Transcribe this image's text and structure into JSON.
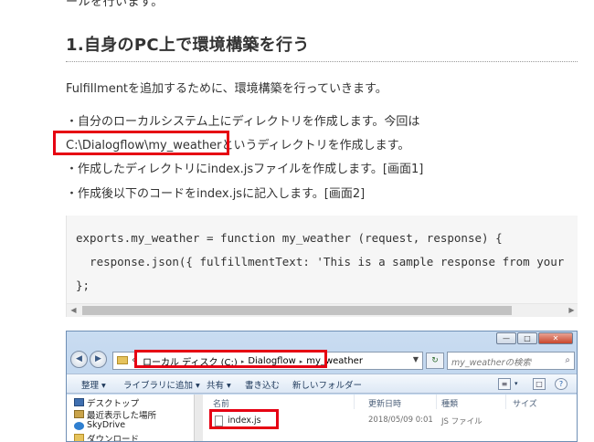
{
  "article": {
    "top_cut_text": "ールを行います。",
    "heading": "1.自身のPC上で環境構築を行う",
    "intro": "Fulfillmentを追加するために、環境構築を行っていきます。",
    "bullet1_line1": "・自分のローカルシステム上にディレクトリを作成します。今回は",
    "bullet1_path": "C:\\Dialogflow\\my_weather",
    "bullet1_line2_rest": "というディレクトリを作成します。",
    "bullet2": "・作成したディレクトリにindex.jsファイルを作成します。[画面1]",
    "bullet3": "・作成後以下のコードをindex.jsに記入します。[画面2]"
  },
  "code": {
    "lines": [
      "exports.my_weather = function my_weather (request, response) {",
      "  response.json({ fulfillmentText: 'This is a sample response from your",
      "};"
    ]
  },
  "explorer": {
    "address": {
      "prefix": "«",
      "crumbs": [
        "ローカル ディスク (C:)",
        "Dialogflow",
        "my_weather"
      ],
      "separator": "▸"
    },
    "search_placeholder": "my_weatherの検索",
    "toolbar": {
      "organize": "整理 ▾",
      "include_library": "ライブラリに追加 ▾",
      "share": "共有 ▾",
      "burn": "書き込む",
      "new_folder": "新しいフォルダー"
    },
    "nav_items": [
      "デスクトップ",
      "最近表示した場所",
      "SkyDrive",
      "ダウンロード"
    ],
    "columns": {
      "name": "名前",
      "date": "更新日時",
      "type": "種類",
      "size": "サイズ"
    },
    "files": [
      {
        "name": "index.js",
        "date": "2018/05/09 0:01",
        "type": "JS ファイル"
      }
    ]
  },
  "colors": {
    "highlight_red": "#e60012",
    "text": "#333333",
    "code_bg": "#f6f6f6"
  }
}
